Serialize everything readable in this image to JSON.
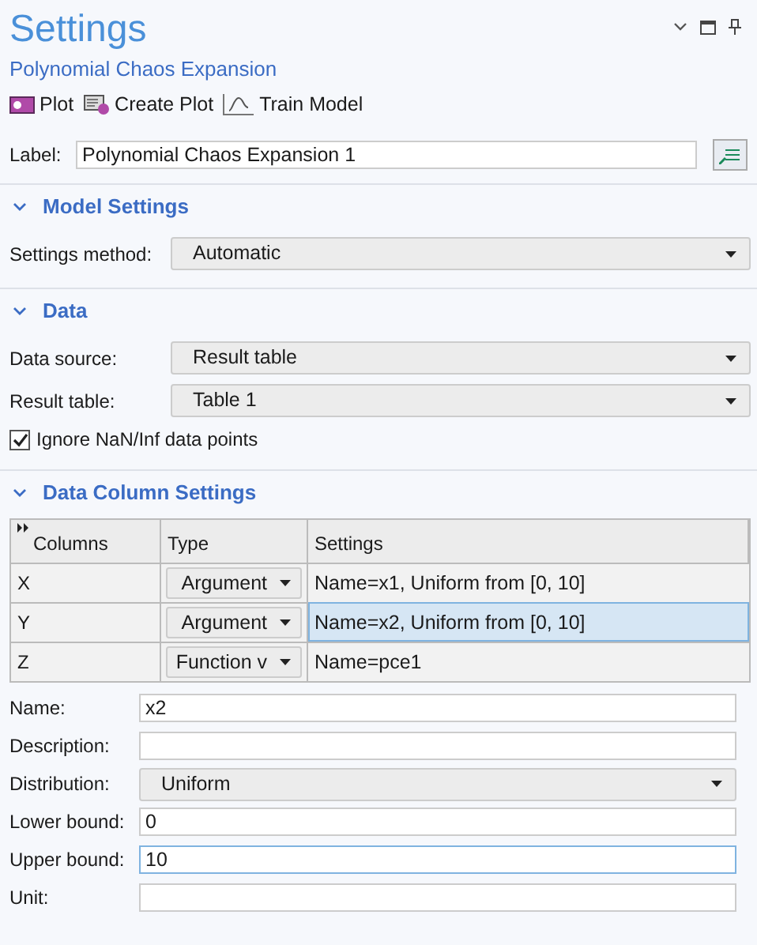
{
  "window": {
    "title": "Settings",
    "subtitle": "Polynomial Chaos Expansion"
  },
  "toolbar": [
    {
      "label": "Plot",
      "kind": "plot"
    },
    {
      "label": "Create Plot",
      "kind": "create"
    },
    {
      "label": "Train Model",
      "kind": "function"
    }
  ],
  "label_field": {
    "label": "Label:",
    "value": "Polynomial Chaos Expansion 1"
  },
  "sections": [
    {
      "title": "Model Settings",
      "expanded": true,
      "rows": [
        {
          "kind": "select",
          "label": "Settings method:",
          "value": "Automatic"
        }
      ]
    },
    {
      "title": "Data",
      "expanded": true,
      "rows": [
        {
          "kind": "select",
          "label": "Data source:",
          "value": "Result table"
        },
        {
          "kind": "select",
          "label": "Result table:",
          "value": "Table 1"
        },
        {
          "kind": "checkbox",
          "label": "Ignore NaN/Inf data points",
          "checked": true
        }
      ]
    },
    {
      "title": "Data Column Settings",
      "expanded": true,
      "table": {
        "columns": [
          "Columns",
          "Type",
          "Settings"
        ],
        "rows": [
          {
            "column": "X",
            "type": "Argument",
            "settings": "Name=x1, Uniform from [0, 10]",
            "selected": false
          },
          {
            "column": "Y",
            "type": "Argument",
            "settings": "Name=x2, Uniform from [0, 10]",
            "selected": true
          },
          {
            "column": "Z",
            "type": "Function v",
            "settings": "Name=pce1",
            "selected": false
          }
        ]
      },
      "rows": [
        {
          "kind": "text",
          "label": "Name:",
          "value": "x2",
          "focused": false
        },
        {
          "kind": "text",
          "label": "Description:",
          "focused": false
        },
        {
          "kind": "select",
          "label": "Distribution:",
          "value": "Uniform"
        },
        {
          "kind": "text",
          "label": "Lower bound:",
          "value": "0",
          "focused": false
        },
        {
          "kind": "text",
          "label": "Upper bound:",
          "value": "10",
          "focused": true
        },
        {
          "kind": "text",
          "label": "Unit:",
          "focused": false
        }
      ]
    }
  ]
}
